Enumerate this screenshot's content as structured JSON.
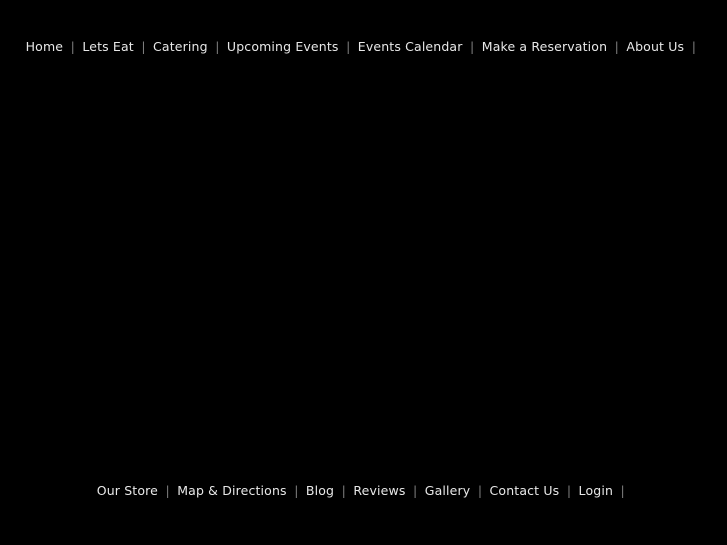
{
  "page": {
    "background_color": "#000000",
    "text_color": "#e8e8e8",
    "separator_color": "#7d7d7d",
    "separator_glyph": "|"
  },
  "top_nav": {
    "items": [
      {
        "label": "Home"
      },
      {
        "label": "Lets Eat"
      },
      {
        "label": "Catering"
      },
      {
        "label": "Upcoming Events"
      },
      {
        "label": "Events Calendar"
      },
      {
        "label": "Make a Reservation"
      },
      {
        "label": "About Us"
      }
    ]
  },
  "bottom_nav": {
    "items": [
      {
        "label": "Our Store"
      },
      {
        "label": "Map & Directions"
      },
      {
        "label": "Blog"
      },
      {
        "label": "Reviews"
      },
      {
        "label": "Gallery"
      },
      {
        "label": "Contact Us"
      },
      {
        "label": "Login"
      }
    ]
  },
  "content": {
    "body_text": ""
  }
}
